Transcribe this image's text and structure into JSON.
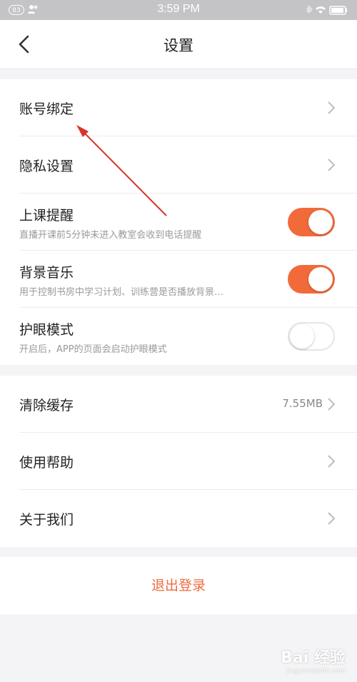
{
  "status_bar": {
    "time": "3:59 PM",
    "battery_badge": "83"
  },
  "nav": {
    "title": "设置"
  },
  "section1": {
    "items": [
      {
        "label": "账号绑定"
      },
      {
        "label": "隐私设置"
      },
      {
        "label": "上课提醒",
        "sub": "直播开课前5分钟未进入教室会收到电话提醒",
        "toggle": true
      },
      {
        "label": "背景音乐",
        "sub": "用于控制书房中学习计划、训练营是否播放背景…",
        "toggle": true
      },
      {
        "label": "护眼模式",
        "sub": "开启后，APP的页面会启动护眼模式",
        "toggle": false
      }
    ]
  },
  "section2": {
    "items": [
      {
        "label": "清除缓存",
        "value": "7.55MB"
      },
      {
        "label": "使用帮助"
      },
      {
        "label": "关于我们"
      }
    ]
  },
  "logout_label": "退出登录",
  "watermark": {
    "text": "Bai 经验",
    "url": "jingyan.baidu.com"
  },
  "colors": {
    "accent": "#f36a3a",
    "logout": "#ef6b3c",
    "annotation_arrow": "#d9342b"
  }
}
